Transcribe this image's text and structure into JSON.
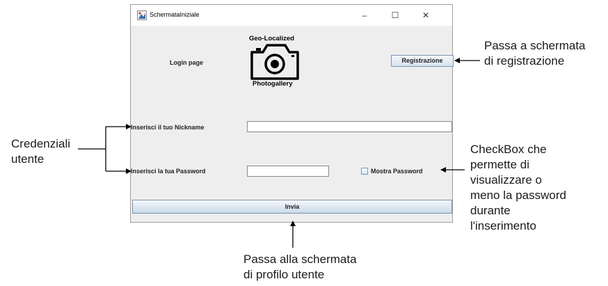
{
  "window": {
    "title": "SchermataIniziale",
    "controls": {
      "minimize": "–",
      "maximize": "☐",
      "close": "✕"
    }
  },
  "login_label": "Login page",
  "logo": {
    "top_text": "Geo-Localized",
    "bottom_text": "Photogallery"
  },
  "register_button": "Registrazione",
  "nickname_label": "Inserisci il tuo Nickname",
  "nickname_value": "",
  "password_label": "Inserisci la tua Password",
  "password_value": "",
  "show_password_label": "Mostra Password",
  "submit_button": "Invia",
  "annotations": {
    "register_line1": "Passa a schermata",
    "register_line2": "di registrazione",
    "credentials_line1": "Credenziali",
    "credentials_line2": "utente",
    "checkbox_line1": "CheckBox che",
    "checkbox_line2": "permette di",
    "checkbox_line3": "visualizzare o",
    "checkbox_line4": "meno la password",
    "checkbox_line5": "durante",
    "checkbox_line6": "l'inserimento",
    "submit_line1": "Passa alla schermata",
    "submit_line2": "di profilo utente"
  }
}
